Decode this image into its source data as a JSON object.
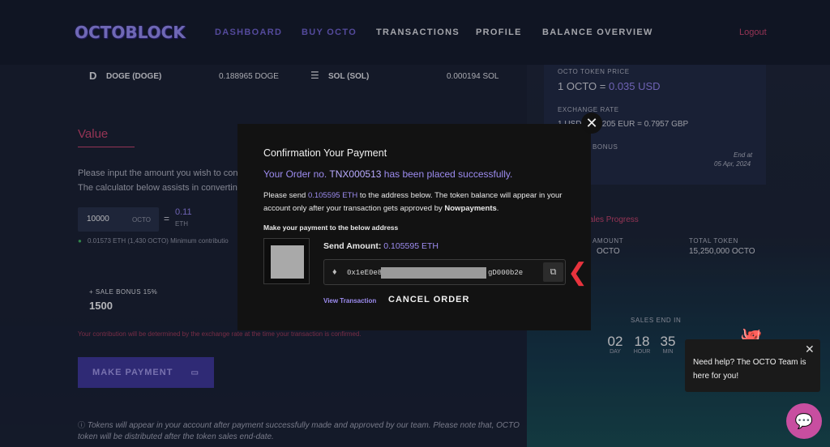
{
  "nav": {
    "logo": "OCTOBLOCK",
    "links": [
      "DASHBOARD",
      "BUY OCTO",
      "TRANSACTIONS",
      "PROFILE",
      "BALANCE OVERVIEW"
    ],
    "logout": "Logout"
  },
  "crypto_rows": [
    {
      "name": "DOGE (DOGE)",
      "value": "0.188965 DOGE"
    },
    {
      "name": "SOL (SOL)",
      "value": "0.000194 SOL"
    }
  ],
  "token_panel": {
    "price_label": "OCTO TOKEN PRICE",
    "price_value": "1 OCTO = ",
    "price_usd": "0.035 USD",
    "exchange_label": "EXCHANGE RATE",
    "exchange_value": "1 USD = 0.9205 EUR = 0.7957 GBP",
    "bonus_label": "BONUS",
    "end_label": "End at",
    "end_date": "05 Apr, 2024"
  },
  "calculator": {
    "title": "Value",
    "hint1": "Please input the amount you wish to contri",
    "hint2": "The calculator below assists in converting",
    "input_value": "10000",
    "input_unit": "OCTO",
    "eq": "=",
    "eth_value": "0.11",
    "eth_unit": "ETH",
    "min_contribution": "0.01573 ETH (1,430 OCTO) Minimum contributio",
    "sale_bonus_label": "+ SALE BONUS 15%",
    "sale_bonus_value": "1500",
    "warning": "Your contribution will be determined by the exchange rate at the time your transaction is confirmed.",
    "make_payment": "MAKE PAYMENT",
    "note": "Tokens will appear in your account after payment successfully made and approved by our team. Please note that, OCTO token will be distributed after the token sales end-date."
  },
  "sales": {
    "title": "Sales Progress",
    "raised_label": "AMOUNT",
    "raised_value": "OCTO",
    "total_label": "TOTAL TOKEN",
    "total_value": "15,250,000 OCTO",
    "ends_label": "SALES END IN",
    "countdown": [
      {
        "num": "02",
        "unit": "DAY"
      },
      {
        "num": "18",
        "unit": "HOUR"
      },
      {
        "num": "35",
        "unit": "MIN"
      }
    ]
  },
  "modal": {
    "title": "Confirmation Your Payment",
    "order_prefix": "Your Order no. ",
    "order_no": "TNX000513",
    "order_suffix": " has been placed successfully.",
    "send_prefix": "Please send ",
    "send_amount": "0.105595 ETH",
    "send_suffix": " to the address below. The token balance will appear in your account only after your transaction gets approved by ",
    "provider": "Nowpayments",
    "send_end": ".",
    "make_payment_label": "Make your payment to the below address",
    "amount_label": "Send Amount: ",
    "amount_value": "0.105595 ETH",
    "address_start": "0x1eE0e8",
    "address_end": "gD000b2e",
    "view_tx": "View Transaction",
    "cancel": "CANCEL ORDER"
  },
  "help": {
    "text": "Need help? The OCTO Team is here for you!"
  },
  "colors": {
    "accent": "#9d8cf0",
    "brand_pink": "#c0436d",
    "arrow": "#e8333d"
  }
}
